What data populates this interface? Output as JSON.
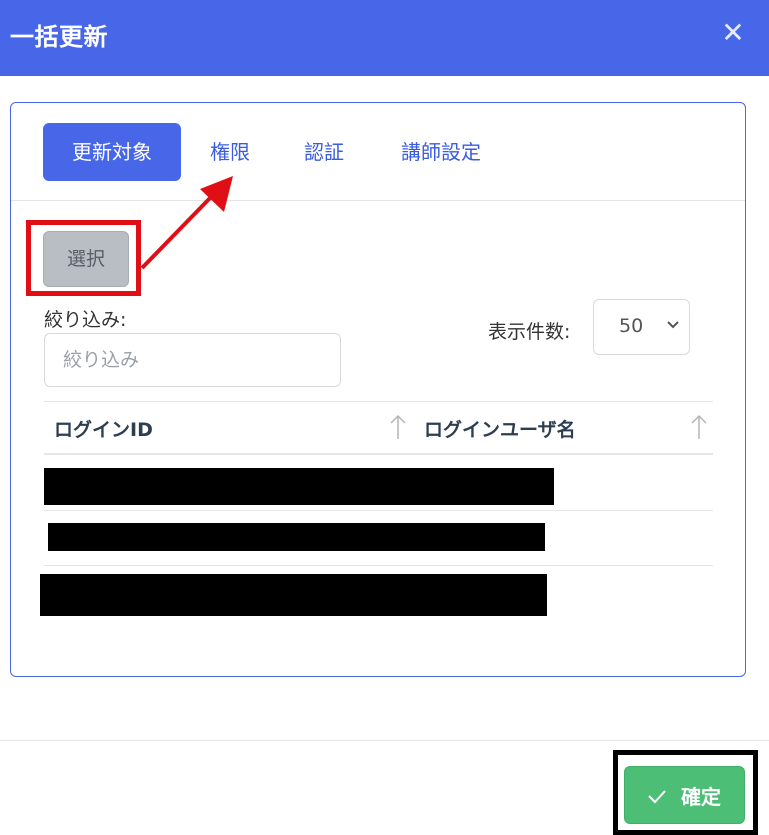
{
  "dialog": {
    "title": "一括更新",
    "close_icon": "close-icon"
  },
  "tabs": [
    {
      "label": "更新対象",
      "active": true
    },
    {
      "label": "権限",
      "active": false
    },
    {
      "label": "認証",
      "active": false
    },
    {
      "label": "講師設定",
      "active": false
    }
  ],
  "select_button": {
    "label": "選択"
  },
  "filter": {
    "label": "絞り込み:",
    "placeholder": "絞り込み",
    "value": ""
  },
  "page_size": {
    "label": "表示件数:",
    "selected": "50"
  },
  "table": {
    "columns": [
      "ログインID",
      "ログインユーザ名"
    ],
    "sort_icon": "arrow-up-icon",
    "rows": [
      "redacted",
      "redacted",
      "redacted"
    ]
  },
  "footer": {
    "confirm_label": "確定",
    "confirm_icon": "check-icon"
  },
  "colors": {
    "header": "#4767e8",
    "tab_active": "#4767e8",
    "annotation_red": "#e00f16",
    "confirm_green": "#4cbe76"
  }
}
